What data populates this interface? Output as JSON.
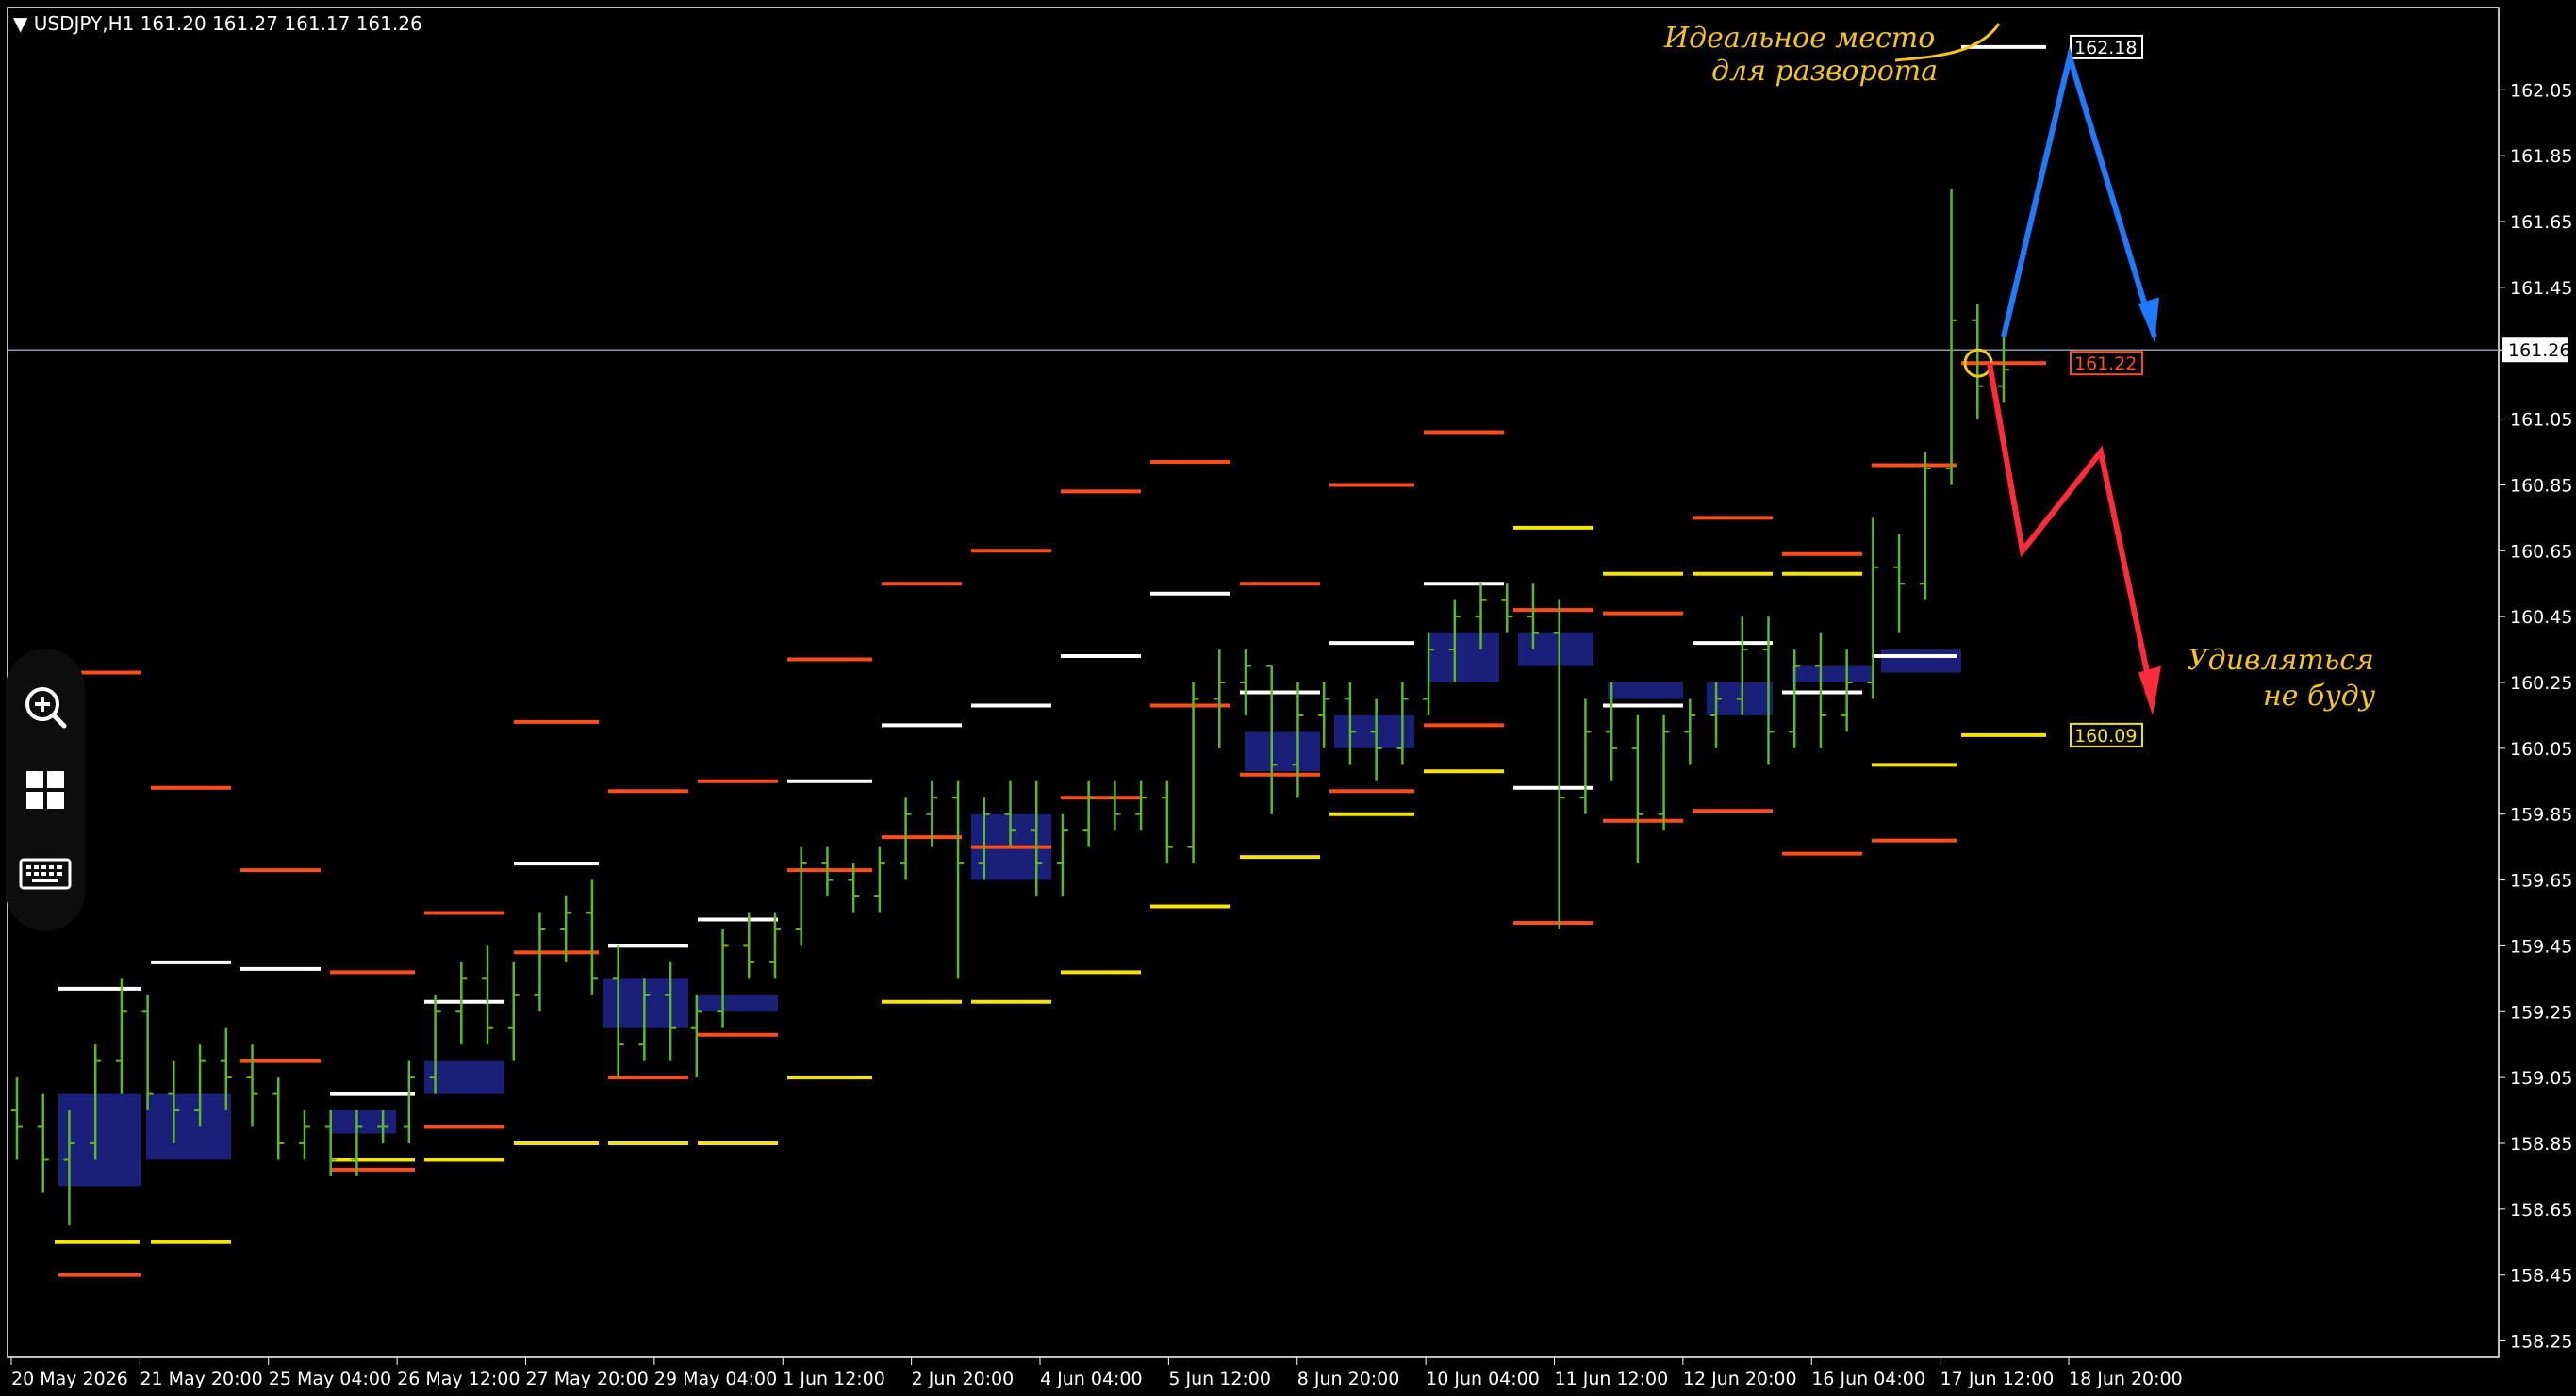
{
  "header": {
    "arrow_glyph": "▼",
    "symbol": "USDJPY,H1",
    "ohlc": "161.20 161.27 161.17 161.26"
  },
  "colors": {
    "background": "#000000",
    "candles": "#5fb81e",
    "level_white": "#ffffff",
    "level_orange": "#ff4d1a",
    "level_yellow": "#f5e400",
    "zone_fill": "#1a1f7a",
    "current_price_line": "#8a9bb0",
    "arrow_blue": "#1e7bff",
    "arrow_red": "#ff2a3a",
    "annotation": "#f5c518"
  },
  "toolbar": {
    "buttons": [
      {
        "name": "zoom-in-icon"
      },
      {
        "name": "grid-layout-icon"
      },
      {
        "name": "keyboard-icon"
      }
    ]
  },
  "chart_data": {
    "type": "candlestick",
    "symbol": "USDJPY",
    "timeframe": "H1",
    "current_price": 161.26,
    "ylim": [
      158.2,
      162.3
    ],
    "y_ticks": [
      "162.05",
      "161.85",
      "161.65",
      "161.45",
      "161.26",
      "161.05",
      "160.85",
      "160.65",
      "160.45",
      "160.25",
      "160.05",
      "159.85",
      "159.65",
      "159.45",
      "159.25",
      "159.05",
      "158.85",
      "158.65",
      "158.45",
      "158.25"
    ],
    "x_ticks": [
      "20 May 2026",
      "21 May 20:00",
      "25 May 04:00",
      "26 May 12:00",
      "27 May 20:00",
      "29 May 04:00",
      "1 Jun 12:00",
      "2 Jun 20:00",
      "4 Jun 04:00",
      "5 Jun 12:00",
      "8 Jun 20:00",
      "10 Jun 04:00",
      "11 Jun 12:00",
      "12 Jun 20:00",
      "16 Jun 04:00",
      "17 Jun 12:00",
      "18 Jun 20:00"
    ],
    "price_labels": [
      {
        "text": "162.18",
        "value": 162.18,
        "color": "#ffffff"
      },
      {
        "text": "161.22",
        "value": 161.22,
        "color": "#ff4d1a"
      },
      {
        "text": "160.09",
        "value": 160.09,
        "color": "#f5e400"
      }
    ],
    "series": [
      {
        "values": [
          [
            0,
            158.95,
            159.05,
            158.8,
            158.9
          ],
          [
            1,
            158.9,
            159.0,
            158.7,
            158.8
          ],
          [
            2,
            158.8,
            158.95,
            158.6,
            158.85
          ],
          [
            3,
            158.85,
            159.15,
            158.8,
            159.1
          ],
          [
            4,
            159.1,
            159.35,
            159.0,
            159.25
          ],
          [
            5,
            159.25,
            159.3,
            158.95,
            159.0
          ],
          [
            6,
            159.0,
            159.1,
            158.85,
            158.95
          ],
          [
            7,
            158.95,
            159.15,
            158.9,
            159.1
          ],
          [
            8,
            159.1,
            159.2,
            158.95,
            159.05
          ],
          [
            9,
            159.05,
            159.15,
            158.9,
            159.0
          ],
          [
            10,
            159.0,
            159.05,
            158.8,
            158.85
          ],
          [
            11,
            158.85,
            158.95,
            158.8,
            158.9
          ],
          [
            12,
            158.9,
            158.95,
            158.75,
            158.8
          ],
          [
            13,
            158.8,
            158.95,
            158.75,
            158.9
          ],
          [
            14,
            158.9,
            158.95,
            158.85,
            158.9
          ],
          [
            15,
            158.9,
            159.1,
            158.85,
            159.05
          ],
          [
            16,
            159.05,
            159.3,
            159.0,
            159.25
          ],
          [
            17,
            159.25,
            159.4,
            159.15,
            159.35
          ],
          [
            18,
            159.35,
            159.45,
            159.15,
            159.2
          ],
          [
            19,
            159.2,
            159.4,
            159.1,
            159.3
          ],
          [
            20,
            159.3,
            159.55,
            159.25,
            159.5
          ],
          [
            21,
            159.5,
            159.6,
            159.4,
            159.55
          ],
          [
            22,
            159.55,
            159.65,
            159.3,
            159.35
          ],
          [
            23,
            159.35,
            159.45,
            159.05,
            159.15
          ],
          [
            24,
            159.15,
            159.35,
            159.1,
            159.3
          ],
          [
            25,
            159.3,
            159.4,
            159.1,
            159.2
          ],
          [
            26,
            159.2,
            159.3,
            159.05,
            159.25
          ],
          [
            27,
            159.25,
            159.5,
            159.2,
            159.45
          ],
          [
            28,
            159.45,
            159.55,
            159.35,
            159.4
          ],
          [
            29,
            159.4,
            159.55,
            159.35,
            159.5
          ],
          [
            30,
            159.5,
            159.75,
            159.45,
            159.7
          ],
          [
            31,
            159.7,
            159.75,
            159.6,
            159.65
          ],
          [
            32,
            159.65,
            159.7,
            159.55,
            159.6
          ],
          [
            33,
            159.6,
            159.75,
            159.55,
            159.7
          ],
          [
            34,
            159.7,
            159.9,
            159.65,
            159.85
          ],
          [
            35,
            159.85,
            159.95,
            159.75,
            159.9
          ],
          [
            36,
            159.9,
            159.95,
            159.35,
            159.7
          ],
          [
            37,
            159.7,
            159.9,
            159.65,
            159.85
          ],
          [
            38,
            159.85,
            159.95,
            159.75,
            159.8
          ],
          [
            39,
            159.8,
            159.95,
            159.6,
            159.7
          ],
          [
            40,
            159.7,
            159.85,
            159.6,
            159.8
          ],
          [
            41,
            159.8,
            159.95,
            159.75,
            159.9
          ],
          [
            42,
            159.9,
            159.95,
            159.8,
            159.85
          ],
          [
            43,
            159.85,
            159.95,
            159.8,
            159.9
          ],
          [
            44,
            159.9,
            159.95,
            159.7,
            159.75
          ],
          [
            45,
            159.75,
            160.25,
            159.7,
            160.2
          ],
          [
            46,
            160.2,
            160.35,
            160.05,
            160.25
          ],
          [
            47,
            160.25,
            160.35,
            160.15,
            160.3
          ],
          [
            48,
            160.3,
            160.3,
            159.85,
            160.0
          ],
          [
            49,
            160.0,
            160.25,
            159.9,
            160.15
          ],
          [
            50,
            160.15,
            160.25,
            160.05,
            160.2
          ],
          [
            51,
            160.2,
            160.25,
            160.0,
            160.1
          ],
          [
            52,
            160.1,
            160.2,
            159.95,
            160.05
          ],
          [
            53,
            160.05,
            160.25,
            160.0,
            160.2
          ],
          [
            54,
            160.2,
            160.4,
            160.15,
            160.35
          ],
          [
            55,
            160.35,
            160.5,
            160.25,
            160.45
          ],
          [
            56,
            160.45,
            160.55,
            160.35,
            160.5
          ],
          [
            57,
            160.5,
            160.55,
            160.4,
            160.45
          ],
          [
            58,
            160.45,
            160.55,
            160.35,
            160.4
          ],
          [
            59,
            160.4,
            160.5,
            159.5,
            159.9
          ],
          [
            60,
            159.9,
            160.2,
            159.85,
            160.1
          ],
          [
            61,
            160.1,
            160.25,
            159.95,
            160.05
          ],
          [
            62,
            160.05,
            160.15,
            159.7,
            159.85
          ],
          [
            63,
            159.85,
            160.15,
            159.8,
            160.1
          ],
          [
            64,
            160.1,
            160.2,
            160.0,
            160.15
          ],
          [
            65,
            160.15,
            160.25,
            160.05,
            160.2
          ],
          [
            66,
            160.2,
            160.45,
            160.15,
            160.35
          ],
          [
            67,
            160.35,
            160.45,
            160.0,
            160.1
          ],
          [
            68,
            160.1,
            160.35,
            160.05,
            160.3
          ],
          [
            69,
            160.3,
            160.4,
            160.05,
            160.15
          ],
          [
            70,
            160.15,
            160.35,
            160.1,
            160.25
          ],
          [
            71,
            160.25,
            160.75,
            160.2,
            160.6
          ],
          [
            72,
            160.6,
            160.7,
            160.4,
            160.55
          ],
          [
            73,
            160.55,
            160.95,
            160.5,
            160.9
          ],
          [
            74,
            160.9,
            161.75,
            160.85,
            161.35
          ],
          [
            75,
            161.35,
            161.4,
            161.05,
            161.15
          ],
          [
            76,
            161.15,
            161.3,
            161.1,
            161.2
          ]
        ]
      }
    ]
  },
  "annotations": {
    "top_note_line1": "Идеальное место",
    "top_note_line2": "для разворота",
    "bottom_note_line1": "Удивляться",
    "bottom_note_line2": "не буду"
  }
}
